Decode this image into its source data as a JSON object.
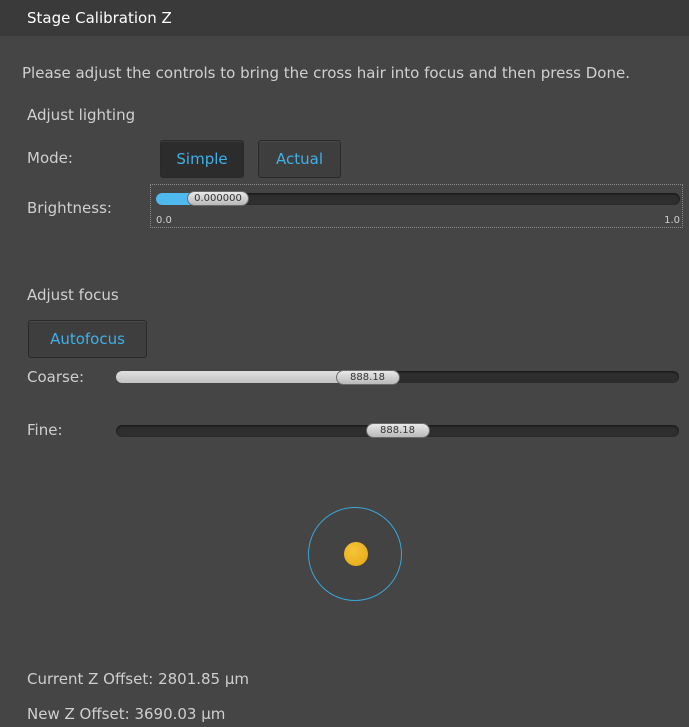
{
  "window": {
    "title": "Stage Calibration Z"
  },
  "instructions": "Please adjust the controls to bring the cross hair into focus and then press Done.",
  "lighting": {
    "heading": "Adjust lighting",
    "mode_label": "Mode:",
    "modes": [
      {
        "label": "Simple",
        "selected": true
      },
      {
        "label": "Actual",
        "selected": false
      }
    ],
    "brightness_label": "Brightness:",
    "brightness_value": "0.000000",
    "brightness_min": "0.0",
    "brightness_max": "1.0",
    "brightness_fraction": 0.0
  },
  "focus": {
    "heading": "Adjust focus",
    "autofocus_label": "Autofocus",
    "coarse_label": "Coarse:",
    "coarse_value": "888.18",
    "coarse_fraction": 0.44,
    "fine_label": "Fine:",
    "fine_value": "888.18",
    "fine_fraction": 0.5
  },
  "status": {
    "current_label": "Current Z Offset:",
    "current_value": "2801.85 µm",
    "new_label": "New Z Offset:",
    "new_value": "3690.03 µm"
  },
  "colors": {
    "accent": "#3fb0e8",
    "target_dot": "#f0b520",
    "background": "#454545"
  }
}
